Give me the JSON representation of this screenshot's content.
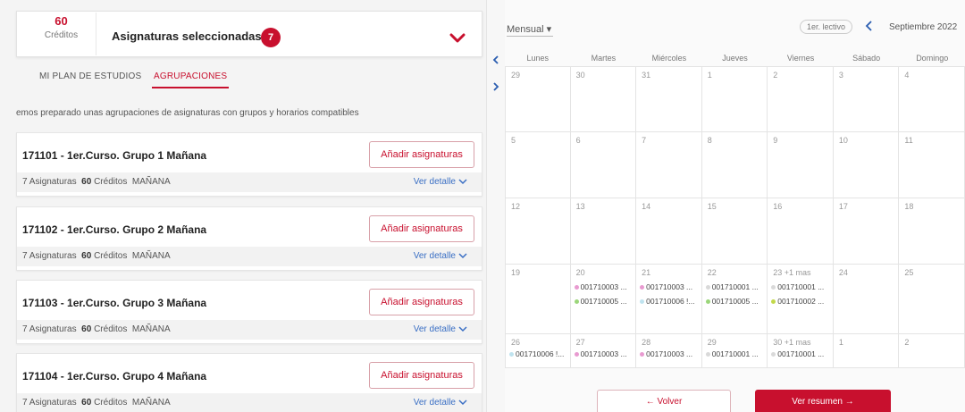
{
  "summary": {
    "credits_value": "60",
    "credits_label": "Créditos",
    "title": "Asignaturas seleccionadas",
    "count": "7"
  },
  "tabs": [
    {
      "label": "MI PLAN DE ESTUDIOS"
    },
    {
      "label": "AGRUPACIONES"
    }
  ],
  "intro_text": "emos preparado unas agrupaciones de asignaturas con grupos y horarios compatibles",
  "groups": [
    {
      "name": "171101 - 1er.Curso. Grupo 1 Mañana",
      "asignaturas_count": "7",
      "asignaturas_label": "Asignaturas",
      "credits_value": "60",
      "credits_label": "Créditos",
      "shift": "MAÑANA",
      "add_label": "Añadir asignaturas",
      "detail_label": "Ver detalle"
    },
    {
      "name": "171102 - 1er.Curso. Grupo 2 Mañana",
      "asignaturas_count": "7",
      "asignaturas_label": "Asignaturas",
      "credits_value": "60",
      "credits_label": "Créditos",
      "shift": "MAÑANA",
      "add_label": "Añadir asignaturas",
      "detail_label": "Ver detalle"
    },
    {
      "name": "171103 - 1er.Curso. Grupo 3 Mañana",
      "asignaturas_count": "7",
      "asignaturas_label": "Asignaturas",
      "credits_value": "60",
      "credits_label": "Créditos",
      "shift": "MAÑANA",
      "add_label": "Añadir asignaturas",
      "detail_label": "Ver detalle"
    },
    {
      "name": "171104 - 1er.Curso. Grupo 4 Mañana",
      "asignaturas_count": "7",
      "asignaturas_label": "Asignaturas",
      "credits_value": "60",
      "credits_label": "Créditos",
      "shift": "MAÑANA",
      "add_label": "Añadir asignaturas",
      "detail_label": "Ver detalle"
    }
  ],
  "calendar": {
    "view": "Mensual",
    "term": "1er. lectivo",
    "month": "Septiembre 2022",
    "days_of_week": [
      "Lunes",
      "Martes",
      "Miércoles",
      "Jueves",
      "Viernes",
      "Sábado",
      "Domingo"
    ],
    "weeks": [
      [
        {
          "d": "29"
        },
        {
          "d": "30"
        },
        {
          "d": "31"
        },
        {
          "d": "1"
        },
        {
          "d": "2"
        },
        {
          "d": "3"
        },
        {
          "d": "4"
        }
      ],
      [
        {
          "d": "5"
        },
        {
          "d": "6"
        },
        {
          "d": "7"
        },
        {
          "d": "8"
        },
        {
          "d": "9"
        },
        {
          "d": "10"
        },
        {
          "d": "11"
        }
      ],
      [
        {
          "d": "12"
        },
        {
          "d": "13"
        },
        {
          "d": "14"
        },
        {
          "d": "15"
        },
        {
          "d": "16"
        },
        {
          "d": "17"
        },
        {
          "d": "18"
        }
      ],
      [
        {
          "d": "19"
        },
        {
          "d": "20",
          "events": [
            {
              "text": "001710003 ...",
              "color": "#e89ad0"
            },
            {
              "text": "001710005 ...",
              "color": "#9bd67a"
            }
          ]
        },
        {
          "d": "21",
          "events": [
            {
              "text": "001710003 ...",
              "color": "#e89ad0"
            },
            {
              "text": "001710006 !...",
              "color": "#bfe3ef"
            }
          ]
        },
        {
          "d": "22",
          "events": [
            {
              "text": "001710001 ...",
              "color": "#d9d9d9"
            },
            {
              "text": "001710005 ...",
              "color": "#9bd67a"
            }
          ]
        },
        {
          "d": "23  +1 mas",
          "events": [
            {
              "text": "001710001 ...",
              "color": "#d9d9d9"
            },
            {
              "text": "001710002 ...",
              "color": "#c2d84a"
            }
          ]
        },
        {
          "d": "24"
        },
        {
          "d": "25"
        }
      ],
      [
        {
          "d": "26",
          "events": [
            {
              "text": "001710006 !...",
              "color": "#bfe3ef"
            }
          ]
        },
        {
          "d": "27",
          "events": [
            {
              "text": "001710003 ...",
              "color": "#e89ad0"
            }
          ]
        },
        {
          "d": "28",
          "events": [
            {
              "text": "001710003 ...",
              "color": "#e89ad0"
            }
          ]
        },
        {
          "d": "29",
          "events": [
            {
              "text": "001710001 ...",
              "color": "#d9d9d9"
            }
          ]
        },
        {
          "d": "30  +1 mas",
          "events": [
            {
              "text": "001710001 ...",
              "color": "#d9d9d9"
            }
          ]
        },
        {
          "d": "1"
        },
        {
          "d": "2"
        }
      ]
    ]
  },
  "footer": {
    "back_label": "← Volver",
    "summary_label": "Ver resumen →"
  },
  "colors": {
    "accent": "#c8102e",
    "link": "#3a6fc4"
  }
}
